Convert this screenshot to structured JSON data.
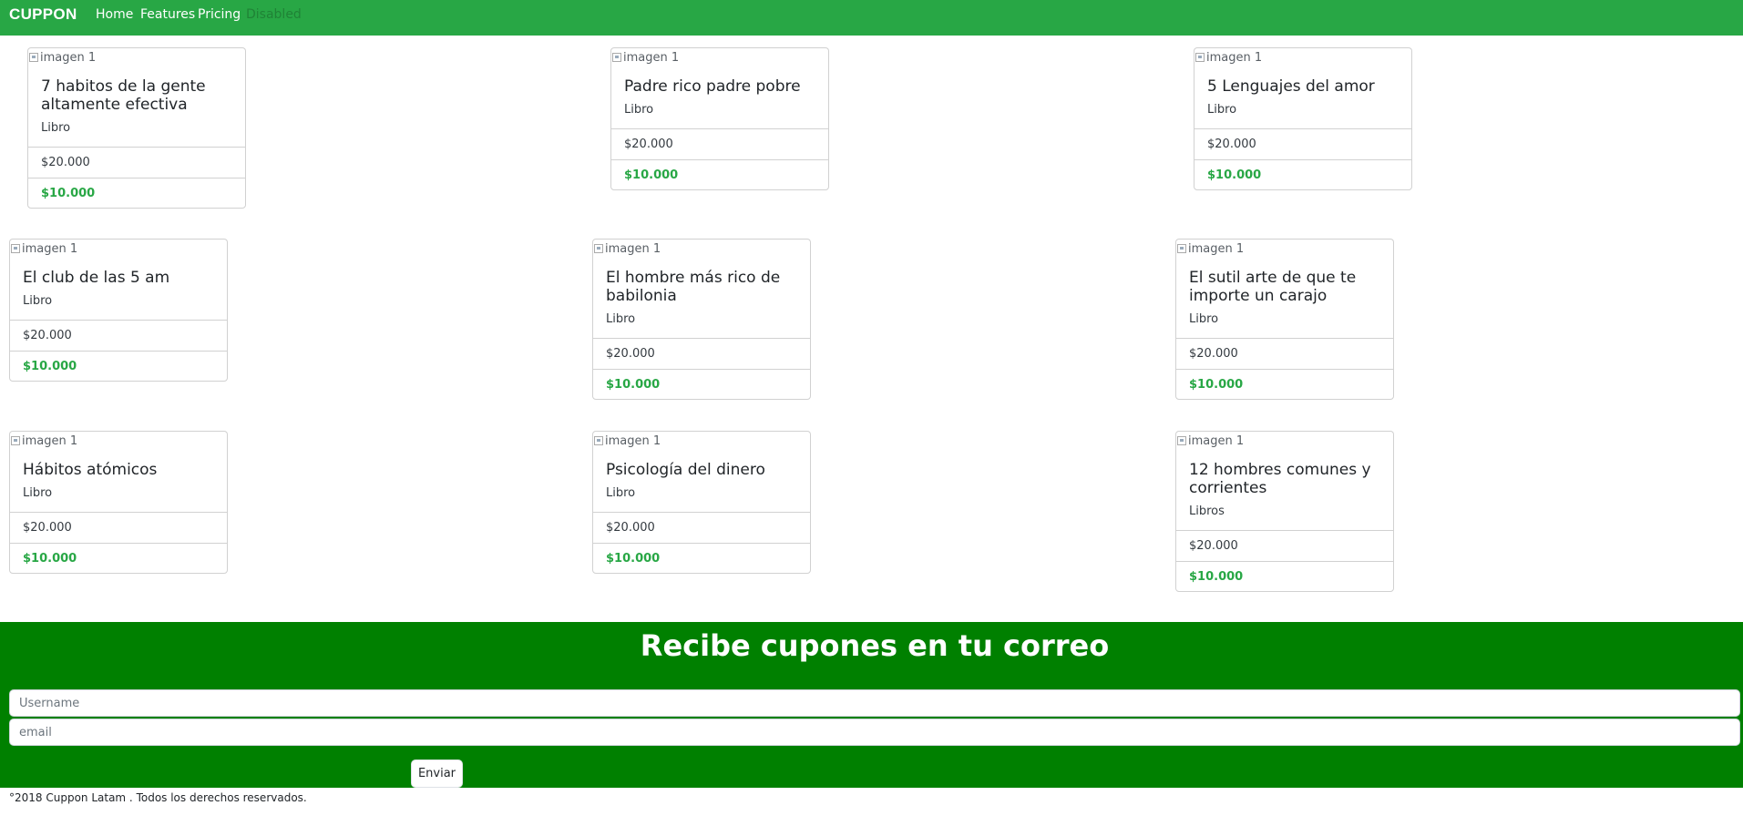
{
  "navbar": {
    "brand": "CUPPON",
    "links": [
      {
        "label": "Home",
        "disabled": false
      },
      {
        "label": "Features",
        "disabled": false
      },
      {
        "label": "Pricing",
        "disabled": false
      },
      {
        "label": "Disabled",
        "disabled": true
      }
    ]
  },
  "cards": [
    {
      "img_alt": "imagen 1",
      "title": "7 habitos de la gente altamente efectiva",
      "subtitle": "Libro",
      "old_price": "$20.000",
      "new_price": "$10.000"
    },
    {
      "img_alt": "imagen 1",
      "title": "Padre rico padre pobre",
      "subtitle": "Libro",
      "old_price": "$20.000",
      "new_price": "$10.000"
    },
    {
      "img_alt": "imagen 1",
      "title": "5 Lenguajes del amor",
      "subtitle": "Libro",
      "old_price": "$20.000",
      "new_price": "$10.000"
    },
    {
      "img_alt": "imagen 1",
      "title": "El club de las 5 am",
      "subtitle": "Libro",
      "old_price": "$20.000",
      "new_price": "$10.000"
    },
    {
      "img_alt": "imagen 1",
      "title": "El hombre más rico de babilonia",
      "subtitle": "Libro",
      "old_price": "$20.000",
      "new_price": "$10.000"
    },
    {
      "img_alt": "imagen 1",
      "title": "El sutil arte de que te importe un carajo",
      "subtitle": "Libro",
      "old_price": "$20.000",
      "new_price": "$10.000"
    },
    {
      "img_alt": "imagen 1",
      "title": "Hábitos atómicos",
      "subtitle": "Libro",
      "old_price": "$20.000",
      "new_price": "$10.000"
    },
    {
      "img_alt": "imagen 1",
      "title": "Psicología del dinero",
      "subtitle": "Libro",
      "old_price": "$20.000",
      "new_price": "$10.000"
    },
    {
      "img_alt": "imagen 1",
      "title": "12 hombres comunes y corrientes",
      "subtitle": "Libros",
      "old_price": "$20.000",
      "new_price": "$10.000"
    }
  ],
  "subscribe": {
    "title": "Recibe cupones en tu correo",
    "username_placeholder": "Username",
    "email_placeholder": "email",
    "submit_label": "Enviar"
  },
  "footer": {
    "text": "°2018 Cuppon Latam . Todos los derechos reservados."
  },
  "colors": {
    "navbar": "#28a745",
    "subscribe_bg": "#008000",
    "price_accent": "#28a745"
  }
}
